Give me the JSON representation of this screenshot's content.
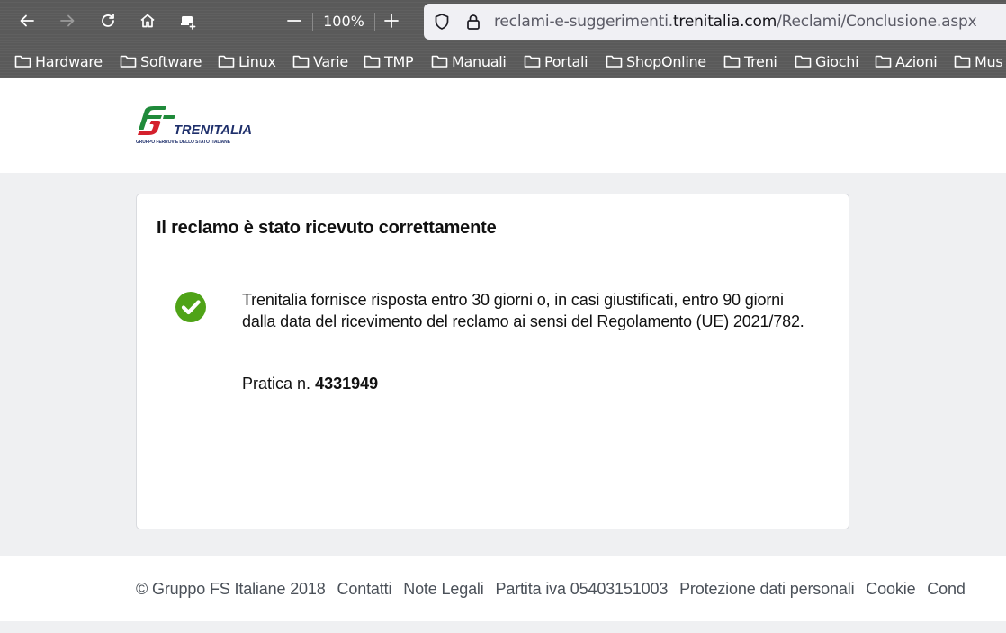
{
  "browser": {
    "zoom_level": "100%",
    "url": {
      "prefix": "reclami-e-suggerimenti.",
      "domain": "trenitalia.com",
      "path": "/Reclami/Conclusione.aspx"
    },
    "bookmarks": [
      "Hardware",
      "Software",
      "Linux",
      "Varie",
      "TMP",
      "Manuali",
      "Portali",
      "ShopOnline",
      "Treni",
      "Giochi",
      "Azioni",
      "Mus"
    ]
  },
  "header": {
    "logo_word": "TRENITALIA",
    "logo_sub": "GRUPPO FERROVIE DELLO STATO ITALIANE",
    "brand_green": "#1f8a3a",
    "brand_red": "#d4202c",
    "brand_blue": "#1e2f6b"
  },
  "card": {
    "title": "Il reclamo è stato ricevuto correttamente",
    "message": "Trenitalia fornisce risposta entro 30 giorni o, in casi giustificati, entro 90 giorni dalla data del ricevimento del reclamo ai sensi del Regolamento (UE) 2021/782.",
    "pratica_label": "Pratica n.",
    "pratica_number": "4331949",
    "status_icon": "check-circle-icon",
    "status_color": "#4fa317"
  },
  "footer": {
    "copyright": "© Gruppo FS Italiane 2018",
    "links": [
      "Contatti",
      "Note Legali",
      "Partita iva 05403151003",
      "Protezione dati personali",
      "Cookie",
      "Cond"
    ]
  }
}
